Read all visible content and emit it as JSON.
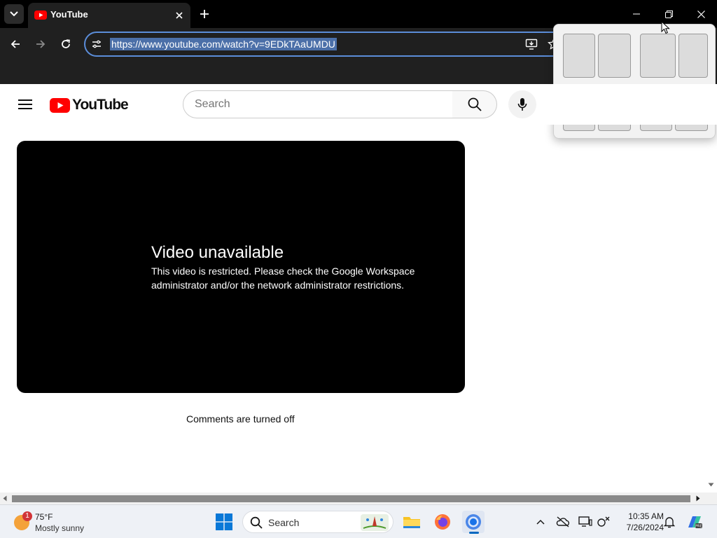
{
  "browser": {
    "tab_title": "YouTube",
    "url": "https://www.youtube.com/watch?v=9EDkTAaUMDU"
  },
  "youtube": {
    "logo_text": "YouTube",
    "search_placeholder": "Search",
    "error_title": "Video unavailable",
    "error_message": "This video is restricted. Please check the Google Workspace administrator and/or the network administrator restrictions.",
    "comments_status": "Comments are turned off"
  },
  "taskbar": {
    "weather_badge": "1",
    "weather_temp": "75°F",
    "weather_condition": "Mostly sunny",
    "search_label": "Search",
    "time": "10:35 AM",
    "date": "7/26/2024"
  },
  "colors": {
    "youtube_red": "#ff0000",
    "chrome_dark": "#202020",
    "omnibox_focus": "#5b8dd9",
    "taskbar_accent": "#0067c0"
  },
  "icons": [
    "tab-list-icon",
    "youtube-favicon-icon",
    "close-icon",
    "plus-icon",
    "minimize-icon",
    "restore-icon",
    "back-arrow-icon",
    "forward-arrow-icon",
    "reload-icon",
    "site-info-icon",
    "install-app-icon",
    "star-icon",
    "hamburger-menu-icon",
    "search-icon",
    "microphone-icon",
    "windows-start-icon",
    "file-explorer-icon",
    "firefox-icon",
    "chrome-icon",
    "chevron-up-icon",
    "onedrive-icon",
    "display-icon",
    "network-icon",
    "bell-icon",
    "copilot-icon"
  ]
}
